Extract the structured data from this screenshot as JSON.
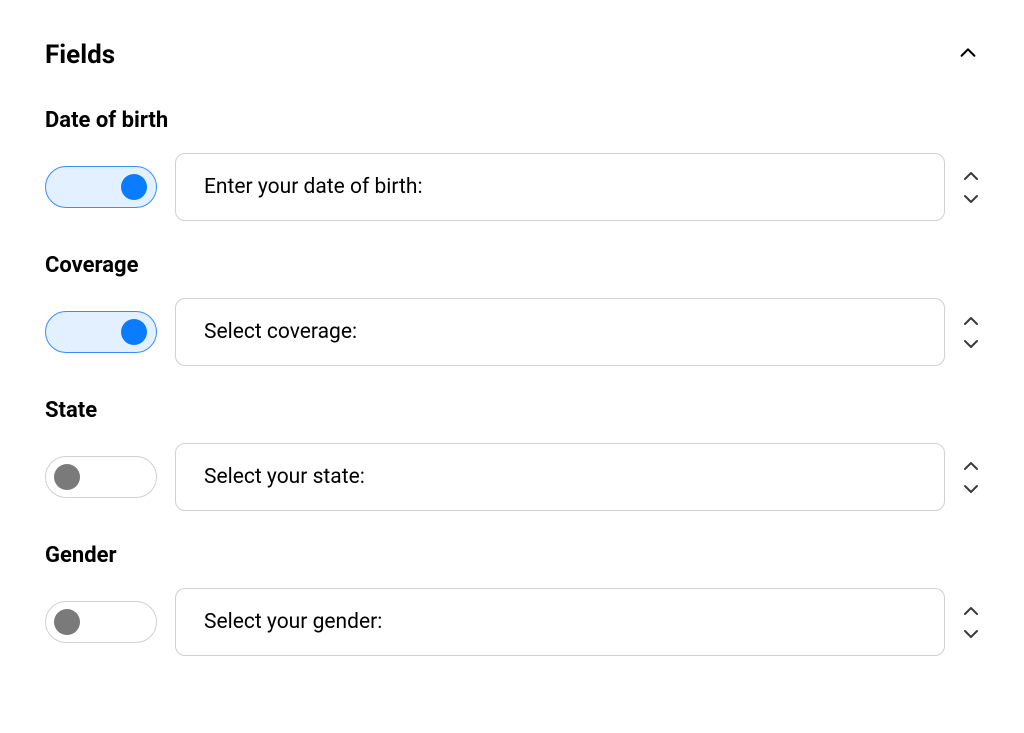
{
  "section": {
    "title": "Fields"
  },
  "fields": [
    {
      "label": "Date of birth",
      "value": "Enter your date of birth:",
      "toggle": true
    },
    {
      "label": "Coverage",
      "value": "Select coverage:",
      "toggle": true
    },
    {
      "label": "State",
      "value": "Select your state:",
      "toggle": false
    },
    {
      "label": "Gender",
      "value": "Select your gender:",
      "toggle": false
    }
  ]
}
